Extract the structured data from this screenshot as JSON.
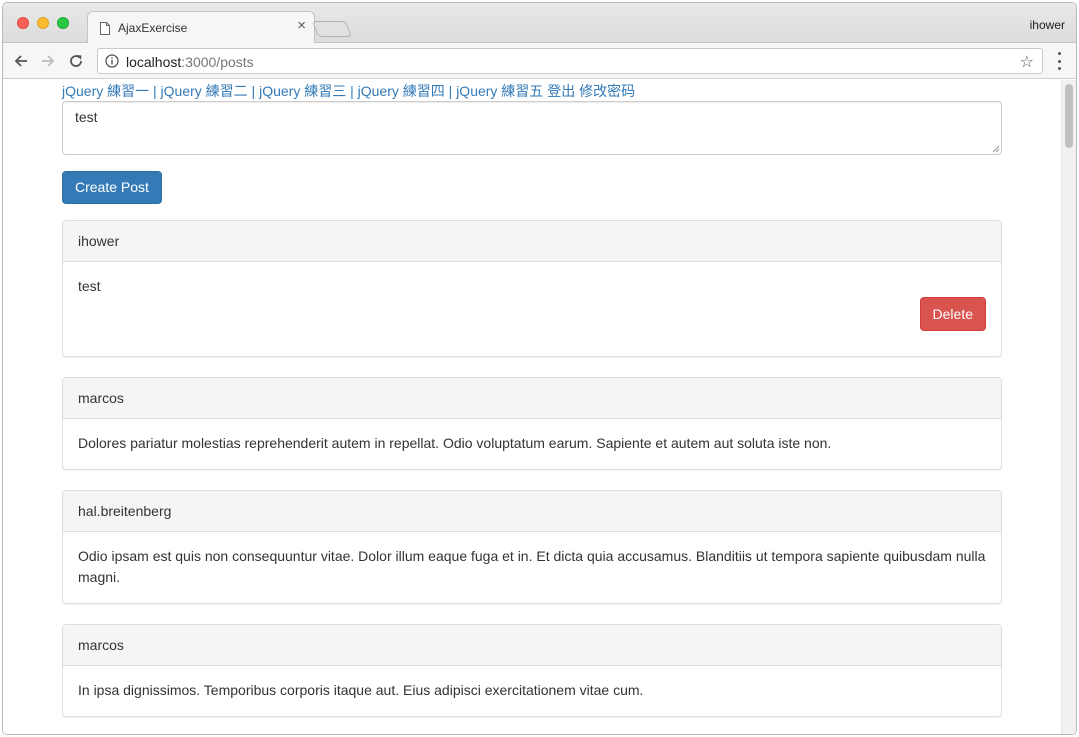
{
  "browser": {
    "tab_title": "AjaxExercise",
    "tab_close": "×",
    "profile_name": "ihower",
    "url_host": "localhost",
    "url_rest": ":3000/posts"
  },
  "nav": {
    "links": [
      "jQuery 練習一",
      "jQuery 練習二",
      "jQuery 練習三",
      "jQuery 練習四",
      "jQuery 練習五"
    ],
    "separator": " | ",
    "logout": "登出",
    "change_password": "修改密码"
  },
  "form": {
    "textarea_value": "test",
    "submit_label": "Create Post"
  },
  "posts": [
    {
      "author": "ihower",
      "body": "test",
      "delete_label": "Delete"
    },
    {
      "author": "marcos",
      "body": "Dolores pariatur molestias reprehenderit autem in repellat. Odio voluptatum earum. Sapiente et autem aut soluta iste non."
    },
    {
      "author": "hal.breitenberg",
      "body": "Odio ipsam est quis non consequuntur vitae. Dolor illum eaque fuga et in. Et dicta quia accusamus. Blanditiis ut tempora sapiente quibusdam nulla magni."
    },
    {
      "author": "marcos",
      "body": "In ipsa dignissimos. Temporibus corporis itaque aut. Eius adipisci exercitationem vitae cum."
    }
  ],
  "colors": {
    "link": "#337ab7",
    "primary": "#337ab7",
    "danger": "#d9534f"
  }
}
